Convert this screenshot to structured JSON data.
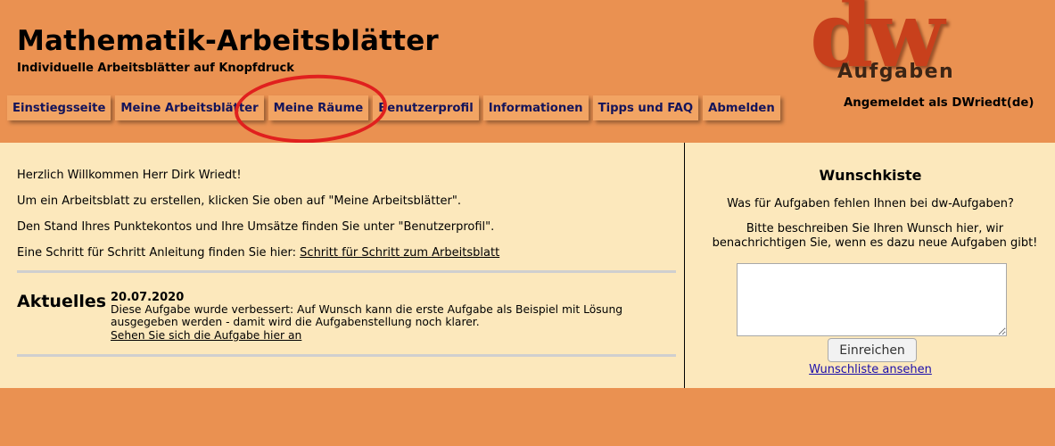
{
  "header": {
    "title": "Mathematik-Arbeitsblätter",
    "subtitle": "Individuelle Arbeitsblätter auf Knopfdruck",
    "login_status": "Angemeldet als DWriedt(de)"
  },
  "logo": {
    "main": "dw",
    "sub": "Aufgaben"
  },
  "nav": [
    "Einstiegsseite",
    "Meine Arbeitsblätter",
    "Meine Räume",
    "Benutzerprofil",
    "Informationen",
    "Tipps und FAQ",
    "Abmelden"
  ],
  "main": {
    "greeting": "Herzlich Willkommen Herr Dirk Wriedt!",
    "create_hint": "Um ein Arbeitsblatt zu erstellen, klicken Sie oben auf \"Meine Arbeitsblätter\".",
    "account_hint": "Den Stand Ihres Punktekontos und Ihre Umsätze finden Sie unter \"Benutzerprofil\".",
    "guide_prefix": "Eine Schritt für Schritt Anleitung finden Sie hier: ",
    "guide_link": "Schritt für Schritt zum Arbeitsblatt"
  },
  "news": {
    "heading": "Aktuelles",
    "date": "20.07.2020",
    "text": "Diese Aufgabe wurde verbessert: Auf Wunsch kann die erste Aufgabe als Beispiel mit Lösung ausgegeben werden - damit wird die Aufgabenstellung noch klarer.",
    "link": "Sehen Sie sich die Aufgabe hier an"
  },
  "wish": {
    "title": "Wunschkiste",
    "question": "Was für Aufgaben fehlen Ihnen bei dw-Aufgaben?",
    "description": "Bitte beschreiben Sie Ihren Wunsch hier, wir benachrichtigen Sie, wenn es dazu neue Aufgaben gibt!",
    "input_value": "",
    "submit_label": "Einreichen",
    "list_link": "Wunschliste ansehen"
  },
  "colors": {
    "page_bg": "#ea9151",
    "nav_bg": "#f2a463",
    "nav_text": "#14145a",
    "content_bg": "#fce8bc",
    "highlight_ring": "#e0201e",
    "logo_red": "#c8401c"
  }
}
